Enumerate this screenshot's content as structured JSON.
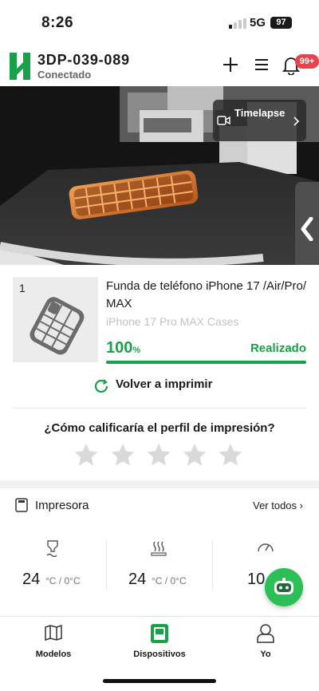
{
  "status_bar": {
    "time": "8:26",
    "network": "5G",
    "battery": "97"
  },
  "header": {
    "device_name": "3DP-039-089",
    "connection_status": "Conectado",
    "notifications_badge": "99+"
  },
  "camera": {
    "timelapse_label": "Timelapse"
  },
  "job": {
    "index": "1",
    "title": "Funda de teléfono iPhone 17 /Air/Pro/MAX",
    "subtitle": "iPhone 17 Pro MAX Cases",
    "progress_value": "100",
    "progress_unit": "%",
    "progress_fraction": 1.0,
    "status": "Realizado",
    "reprint_label": "Volver a imprimir",
    "rating_question": "¿Cómo calificaría el perfil de impresión?",
    "rating_stars_total": 5,
    "rating_value": 0
  },
  "printer": {
    "section_label": "Impresora",
    "see_all": "Ver todos",
    "temps": [
      {
        "value": "24",
        "unit": "°C / 0°C"
      },
      {
        "value": "24",
        "unit": "°C / 0°C"
      },
      {
        "value": "10"
      }
    ]
  },
  "tabbar": {
    "tabs": [
      "Modelos",
      "Dispositivos",
      "Yo"
    ],
    "active": "Dispositivos"
  },
  "colors": {
    "accent": "#1aa04a",
    "badge": "#e5434f",
    "fab": "#2bbf58"
  },
  "icons": [
    "plus-icon",
    "menu-icon",
    "bell-icon",
    "camera-icon",
    "chevron-right-icon",
    "chevron-left-icon",
    "refresh-icon",
    "star-icon",
    "printer-icon",
    "nozzle-temp-icon",
    "bed-temp-icon",
    "speed-gauge-icon",
    "bot-icon",
    "models-icon",
    "devices-icon",
    "profile-icon"
  ]
}
